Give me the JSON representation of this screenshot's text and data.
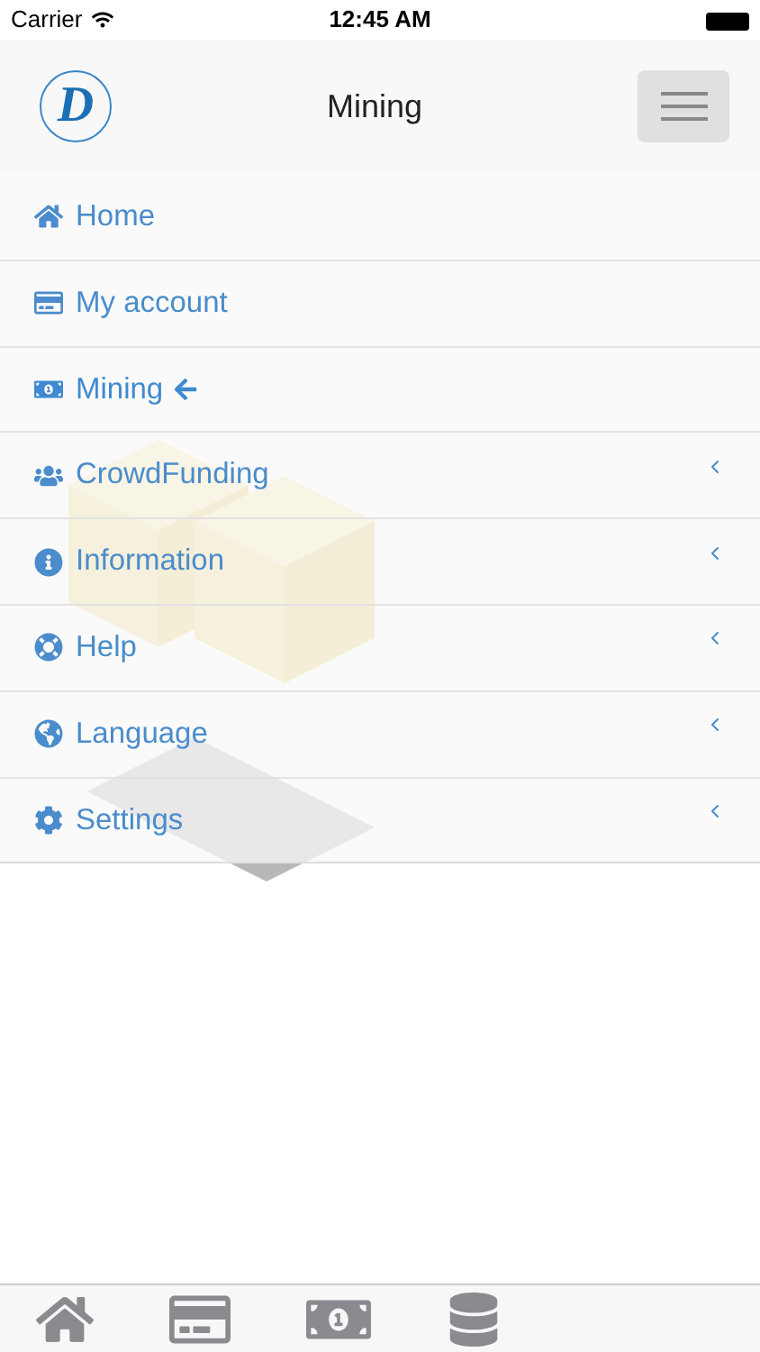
{
  "status_bar": {
    "carrier": "Carrier",
    "time": "12:45 AM"
  },
  "header": {
    "logo": "D",
    "title": "Mining"
  },
  "menu": [
    {
      "label": "Home",
      "selected": false,
      "expandable": false
    },
    {
      "label": "My account",
      "selected": false,
      "expandable": false
    },
    {
      "label": "Mining",
      "selected": true,
      "expandable": false
    },
    {
      "label": "CrowdFunding",
      "selected": false,
      "expandable": true
    },
    {
      "label": "Information",
      "selected": false,
      "expandable": true
    },
    {
      "label": "Help",
      "selected": false,
      "expandable": true
    },
    {
      "label": "Language",
      "selected": false,
      "expandable": true
    },
    {
      "label": "Settings",
      "selected": false,
      "expandable": true
    }
  ]
}
